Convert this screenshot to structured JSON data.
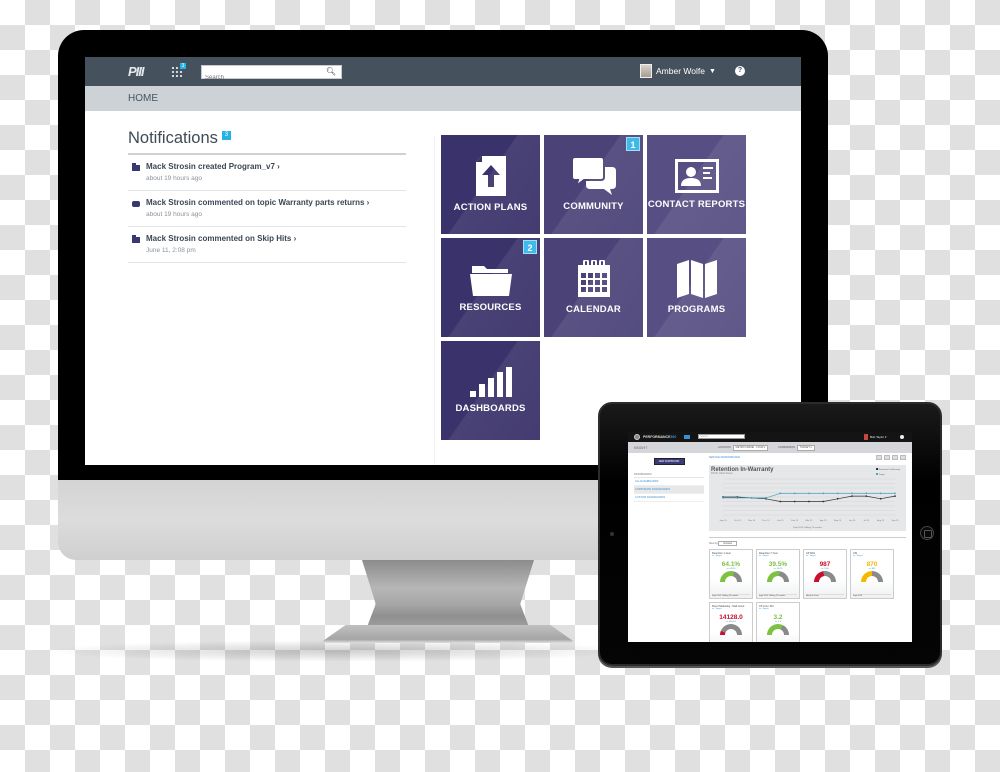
{
  "monitor": {
    "topbar": {
      "logo": "PIII",
      "apps_badge": "3",
      "search_placeholder": "Search",
      "user_name": "Amber Wolfe",
      "help": "?"
    },
    "breadcrumb": "HOME",
    "notifications": {
      "title": "Notifications",
      "count": "3",
      "items": [
        {
          "icon": "folder-icon",
          "text": "Mack Strosin created  Program_v7 ›",
          "time": "about 19 hours ago"
        },
        {
          "icon": "chat-icon",
          "text": "Mack Strosin commented on topic Warranty parts returns ›",
          "time": "about 19 hours ago"
        },
        {
          "icon": "folder-icon",
          "text": "Mack Strosin commented on Skip Hits ›",
          "time": "June 11, 2:08 pm"
        }
      ]
    },
    "tiles": [
      {
        "label": "ACTION PLANS",
        "icon": "upload-document-icon",
        "badge": null
      },
      {
        "label": "COMMUNITY",
        "icon": "chat-bubbles-icon",
        "badge": "1"
      },
      {
        "label": "CONTACT REPORTS",
        "icon": "contact-card-icon",
        "badge": null
      },
      {
        "label": "RESOURCES",
        "icon": "folder-icon",
        "badge": "2"
      },
      {
        "label": "CALENDAR",
        "icon": "calendar-icon",
        "badge": null
      },
      {
        "label": "PROGRAMS",
        "icon": "map-icon",
        "badge": null
      },
      {
        "label": "DASHBOARDS",
        "icon": "signal-bars-icon",
        "badge": null
      }
    ]
  },
  "tablet": {
    "topbar": {
      "logo": "PERFORMANCE",
      "logo_accent": "360",
      "search_placeholder": "Search",
      "user_name": "Bob Taylor ▾"
    },
    "subbar": {
      "title": "NSIGHT",
      "location_label": "LOCATION",
      "location_value": "METRO FRAME · FOUR ▾",
      "comparison_label": "COMPARISON",
      "comparison_value": "TARGET ▾"
    },
    "sidebar": {
      "new_dashboard": "NEW DASHBOARD",
      "heading": "DASHBOARDS",
      "links": [
        "ALL DASHBOARDS",
        "CORPORATE DASHBOARDS",
        "CUSTOM DASHBOARDS"
      ]
    },
    "main": {
      "breadcrumb": "SERVICE PERFORMANCE",
      "view_by_label": "View by",
      "view_by_value": "Related"
    },
    "chart_data": {
      "type": "line",
      "title": "Retention In-Warranty",
      "subtitle": "FOUR - Metro Frame",
      "xlabel": "Sept 2015, Rolling 12 months",
      "legend": [
        "Retention In-Warranty",
        "Target"
      ],
      "legend_position": "top-right",
      "x": [
        "Sep 14",
        "Oct 14",
        "Nov 14",
        "Dec 14",
        "Jan 15",
        "Feb 15",
        "Mar 15",
        "Apr 15",
        "May 15",
        "Jun 15",
        "Jul 15",
        "Aug 15",
        "Sep 15"
      ],
      "series": [
        {
          "name": "Retention In-Warranty",
          "color": "#333333",
          "values": [
            60,
            60,
            59,
            58,
            55,
            55,
            55,
            55,
            58,
            61,
            61,
            58,
            61
          ]
        },
        {
          "name": "Target",
          "color": "#4aa8c4",
          "values": [
            59,
            59,
            59,
            59,
            64,
            64,
            64,
            64,
            64,
            64,
            64,
            64,
            64
          ]
        }
      ],
      "ylim": [
        40,
        80
      ],
      "grid": true
    },
    "cards": [
      {
        "title": "Retention 1-Year",
        "sub": "vs. Target",
        "value": "64.1%",
        "vs": "vs. 63.8%",
        "pct": 100.5,
        "fill": 0.6,
        "color": "#7dc142",
        "foot": "Sept 2015, Rolling 12 months"
      },
      {
        "title": "Retention 7-Year",
        "sub": "vs. Target",
        "value": "39.5%",
        "vs": "vs. 40.2%",
        "pct": 98.3,
        "fill": 0.55,
        "color": "#7dc142",
        "foot": "Sept 2015, Rolling 12 months"
      },
      {
        "title": "CP ROs",
        "sub": "vs. Target",
        "value": "987",
        "vs": "vs. 1100",
        "pct": 89.7,
        "fill": 0.45,
        "color": "#c8102e",
        "foot": "Month to Date"
      },
      {
        "title": "CSI",
        "sub": "vs. Target",
        "value": "870",
        "vs": "vs. 885",
        "pct": 98.3,
        "fill": 0.5,
        "color": "#f5b800",
        "foot": "Sept 2015"
      },
      {
        "title": "Direct Marketing - Mail Count",
        "sub": "vs. Target",
        "value": "14128.0",
        "vs": "vs. 60000.0",
        "pct": 23.5,
        "fill": 0.12,
        "color": "#c8102e",
        "foot": ""
      },
      {
        "title": "CP LOs / RO",
        "sub": "vs. Target",
        "value": "3.2",
        "vs": "vs. 3.0",
        "pct": 106.7,
        "fill": 0.65,
        "color": "#7dc142",
        "foot": ""
      }
    ]
  }
}
